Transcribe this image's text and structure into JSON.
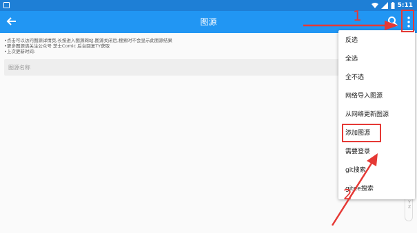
{
  "status_bar": {
    "time": "5:11"
  },
  "app_bar": {
    "title": "图源"
  },
  "notes": [
    "•点击可以访问图源详情页,长按进入图源网站,图源关闭后,搜索时不会显示此图源结果",
    "•更多图源请关注公众号 芝士Comic 后台回复TY获取",
    "•上次更新时间:"
  ],
  "search": {
    "placeholder": "图源名称",
    "value": ""
  },
  "menu": {
    "items": [
      "反选",
      "全选",
      "全不选",
      "网络导入图源",
      "从网络更新图源",
      "添加图源",
      "需要登录",
      "git搜索",
      "gitee搜索"
    ]
  },
  "alphabet_index": [
    "X",
    "Y",
    "Z"
  ],
  "annotations": {
    "step1": "1",
    "step2": "2"
  },
  "colors": {
    "app_bar": "#2196f3",
    "status_bar": "#1e7fd6",
    "annotation": "#e53935"
  }
}
